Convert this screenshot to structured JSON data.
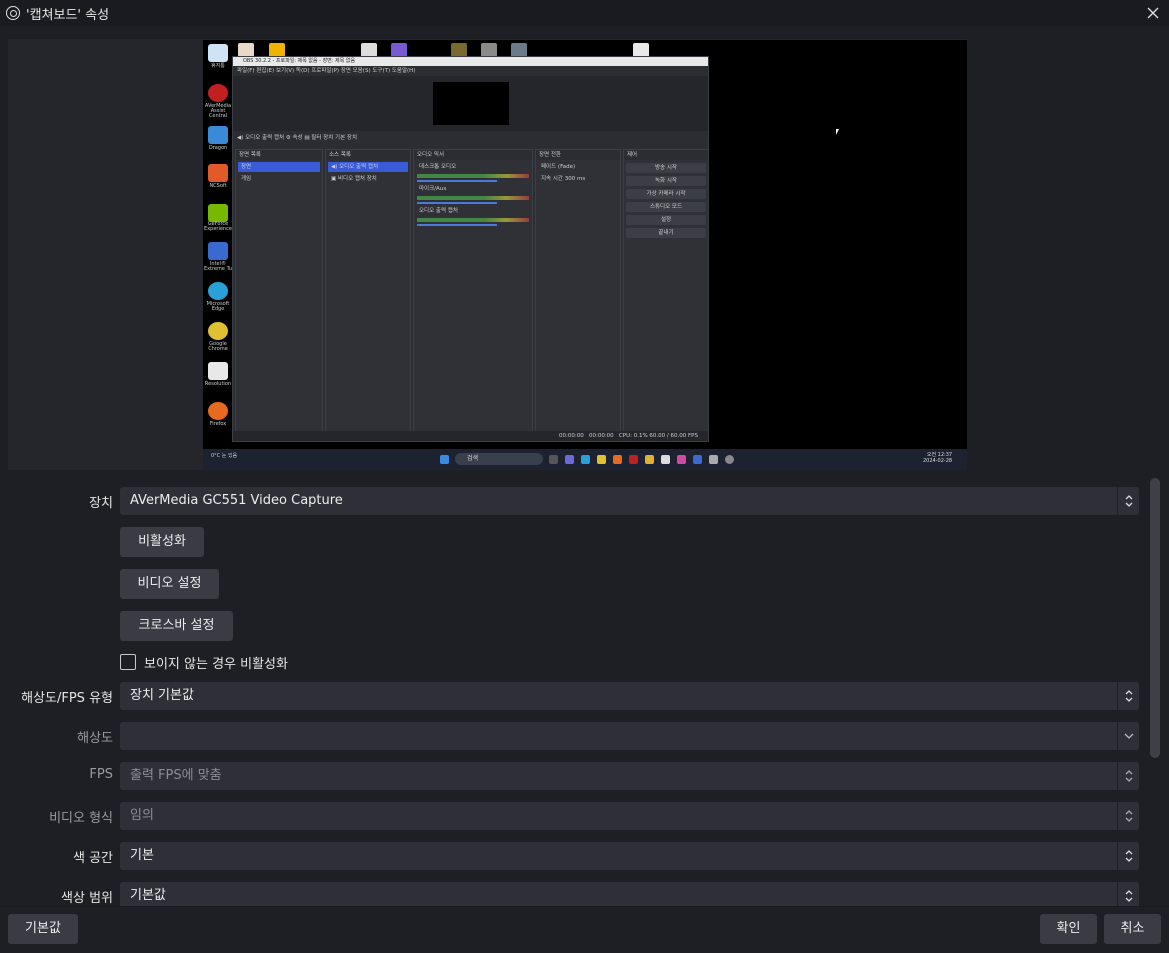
{
  "window": {
    "title": "'캡쳐보드' 속성"
  },
  "form": {
    "device_label": "장치",
    "device_value": "AVerMedia GC551 Video Capture",
    "deactivate_button": "비활성화",
    "video_settings_button": "비디오 설정",
    "crossbar_settings_button": "크로스바 설정",
    "deactivate_when_hidden_label": "보이지 않는 경우 비활성화",
    "deactivate_when_hidden_checked": false,
    "res_fps_type_label": "해상도/FPS 유형",
    "res_fps_type_value": "장치 기본값",
    "resolution_label": "해상도",
    "resolution_value": "",
    "fps_label": "FPS",
    "fps_value": "출력 FPS에 맞춤",
    "video_format_label": "비디오 형식",
    "video_format_value": "임의",
    "color_space_label": "색 공간",
    "color_space_value": "기본",
    "color_range_label": "색상 범위",
    "color_range_value": "기본값"
  },
  "footer": {
    "defaults_button": "기본값",
    "ok_button": "확인",
    "cancel_button": "취소"
  },
  "preview": {
    "obs_title": "OBS 30.2.2 - 프로파일: 제목 없음 - 장면: 제목 없음",
    "obs_menu": "파일(F)  편집(E)  보기(V)  독(D)  프로파일(P)  장면 모음(S)  도구(T)  도움말(H)",
    "source_bar": "◀) 오디오 출력 캡처      ⚙ 속성     ▤ 필터     장치  기본 장치",
    "docks": {
      "scenes_title": "장면 목록",
      "scene_items": [
        "장면",
        "게임"
      ],
      "sources_title": "소스 목록",
      "source_items": [
        "◀) 오디오 출력 캡처",
        "▣ 비디오 캡처 장치"
      ],
      "mixer_title": "오디오 믹서",
      "mixer_items": [
        "데스크톱 오디오",
        "마이크/Aux",
        "오디오 출력 캡처"
      ],
      "transitions_title": "장면 전환",
      "transition_value": "페이드 (Fade)",
      "transition_duration_label": "지속 시간",
      "transition_duration": "300 ms",
      "controls_title": "제어",
      "controls": [
        "방송 시작",
        "녹화 시작",
        "가상 카메라 시작",
        "스튜디오 모드",
        "설정",
        "끝내기"
      ]
    },
    "status": "CPU: 0.1%   60.00 / 60.00 FPS",
    "status_times": [
      "00:00:00",
      "00:00:00"
    ],
    "taskbar_search": "검색",
    "taskbar_weather": "0°C 눈 있음",
    "clock": [
      "오전 12:37",
      "2024-02-28"
    ],
    "desktop_icons": [
      "휴지통",
      "AVerMedia Assist Central",
      "Dragon",
      "NCSoft",
      "GeForce Experience",
      "Intel® Extreme Tu",
      "Microsoft Edge",
      "Google Chrome",
      "Resolution",
      "Firefox"
    ]
  },
  "colors": {
    "background": "#1e1f24",
    "input": "#2f3037",
    "button": "#3a3b43",
    "selected": "#3a5bd8"
  }
}
